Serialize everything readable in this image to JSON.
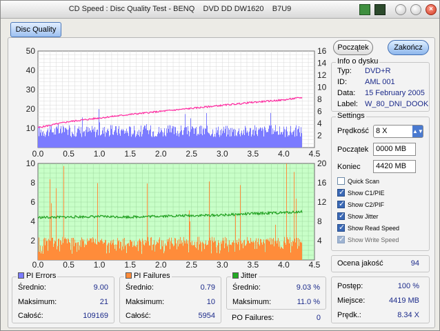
{
  "window": {
    "title": "CD Speed : Disc Quality Test - BENQ    DVD DD DW1620    B7U9",
    "tab_label": "Disc Quality"
  },
  "buttons": {
    "start": "Początek",
    "stop": "Zakończ"
  },
  "disc_info": {
    "title": "Info o dysku",
    "rows": [
      {
        "label": "Typ:",
        "value": "DVD+R"
      },
      {
        "label": "ID:",
        "value": "AML 001"
      },
      {
        "label": "Data:",
        "value": "15 February 2005"
      },
      {
        "label": "Label:",
        "value": "W_80_DNI_DOOK"
      }
    ]
  },
  "settings": {
    "title": "Settings",
    "speed_label": "Prędkość",
    "speed_value": "8 X",
    "start_label": "Początek",
    "start_value": "0000 MB",
    "end_label": "Koniec",
    "end_value": "4420 MB",
    "checkboxes": [
      {
        "label": "Quick Scan",
        "checked": false,
        "disabled": false
      },
      {
        "label": "Show C1/PIE",
        "checked": true,
        "disabled": false
      },
      {
        "label": "Show C2/PIF",
        "checked": true,
        "disabled": false
      },
      {
        "label": "Show Jitter",
        "checked": true,
        "disabled": false
      },
      {
        "label": "Show Read Speed",
        "checked": true,
        "disabled": false
      },
      {
        "label": "Show Write Speed",
        "checked": true,
        "disabled": true
      }
    ]
  },
  "quality": {
    "label": "Ocena jakość",
    "value": "94"
  },
  "progress": {
    "rows": [
      {
        "label": "Postęp:",
        "value": "100 %"
      },
      {
        "label": "Miejsce:",
        "value": "4419 MB"
      },
      {
        "label": "Prędk.:",
        "value": "8.34 X"
      }
    ]
  },
  "stats": {
    "pi_errors": {
      "title": "PI Errors",
      "color": "#7b7bff",
      "avg_label": "Średnio:",
      "avg": "9.00",
      "max_label": "Maksimum:",
      "max": "21",
      "total_label": "Całość:",
      "total": "109169"
    },
    "pi_failures": {
      "title": "PI Failures",
      "color": "#ff8c3a",
      "avg_label": "Średnio:",
      "avg": "0.79",
      "max_label": "Maksimum:",
      "max": "10",
      "total_label": "Całość:",
      "total": "5954"
    },
    "jitter": {
      "title": "Jitter",
      "color": "#22aa22",
      "avg_label": "Średnio:",
      "avg": "9.03 %",
      "max_label": "Maksimum:",
      "max": "11.0 %"
    },
    "po_failures": {
      "label": "PO Failures:",
      "value": "0"
    }
  },
  "chart_data": [
    {
      "type": "bar",
      "title": "",
      "xlabel": "",
      "ylabel": "",
      "xlim": [
        0,
        4.5
      ],
      "ylim": [
        0,
        50
      ],
      "y2lim": [
        0,
        16
      ],
      "x_ticks": [
        "0.0",
        "0.5",
        "1.0",
        "1.5",
        "2.0",
        "2.5",
        "3.0",
        "3.5",
        "4.0",
        "4.5"
      ],
      "y_ticks": [
        "10",
        "20",
        "30",
        "40",
        "50"
      ],
      "y2_ticks": [
        "2",
        "4",
        "6",
        "8",
        "10",
        "12",
        "14",
        "16"
      ],
      "grid": true,
      "series": [
        {
          "name": "PI Errors",
          "kind": "bar",
          "color": "#7b7bff",
          "x_end": 4.3,
          "typical": 9,
          "max": 21
        },
        {
          "name": "Read Speed",
          "kind": "line",
          "axis": "y2",
          "color": "#ff2aa0",
          "points": [
            [
              0.0,
              3.3
            ],
            [
              0.5,
              4.3
            ],
            [
              1.0,
              4.9
            ],
            [
              1.5,
              5.5
            ],
            [
              2.0,
              6.0
            ],
            [
              2.5,
              6.5
            ],
            [
              3.0,
              7.0
            ],
            [
              3.5,
              7.5
            ],
            [
              4.0,
              7.9
            ],
            [
              4.3,
              8.3
            ]
          ]
        }
      ]
    },
    {
      "type": "bar",
      "title": "",
      "xlabel": "",
      "ylabel": "",
      "xlim": [
        0,
        4.5
      ],
      "ylim": [
        0,
        10
      ],
      "y2lim": [
        0,
        20
      ],
      "x_ticks": [
        "0.0",
        "0.5",
        "1.0",
        "1.5",
        "2.0",
        "2.5",
        "3.0",
        "3.5",
        "4.0",
        "4.5"
      ],
      "y_ticks": [
        "2",
        "4",
        "6",
        "8",
        "10"
      ],
      "y2_ticks": [
        "4",
        "8",
        "12",
        "16",
        "20"
      ],
      "grid": true,
      "series": [
        {
          "name": "PI Failures",
          "kind": "bar",
          "color": "#ff8c3a",
          "x_end": 4.3,
          "typical": 2,
          "max": 10
        },
        {
          "name": "Jitter",
          "kind": "line",
          "axis": "y2",
          "color": "#20a020",
          "points": [
            [
              0.0,
              8.8
            ],
            [
              0.5,
              8.9
            ],
            [
              1.0,
              9.0
            ],
            [
              1.5,
              8.9
            ],
            [
              2.0,
              9.1
            ],
            [
              2.5,
              9.2
            ],
            [
              3.0,
              9.3
            ],
            [
              3.5,
              9.6
            ],
            [
              4.0,
              9.8
            ],
            [
              4.3,
              10.0
            ]
          ]
        }
      ]
    }
  ]
}
